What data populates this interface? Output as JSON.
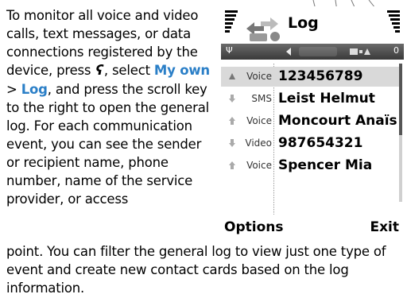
{
  "manual": {
    "p1_a": "To monitor all voice and video calls, text messages, or data connections registered by the device, press",
    "p1_b": ", select",
    "my_own": "My own",
    "gt": ">",
    "log_link": "Log",
    "p1_c": ", and press the scroll key to the right to open the general log. For each communication event, you can see the sender or recipient name, phone number, name of the service provider, or access",
    "p2": "point. You can filter the general log to view just one type of event and create new contact cards based on the log information.",
    "menu_key_icon": "menu-key-icon"
  },
  "phone": {
    "title": "Log",
    "status_left": "Ψ",
    "status_right": "0",
    "entries": [
      {
        "type": "Voice",
        "name": "123456789",
        "icon": "outgoing-call-icon",
        "highlight": true
      },
      {
        "type": "SMS",
        "name": "Leist Helmut",
        "icon": "incoming-arrow-icon",
        "highlight": false
      },
      {
        "type": "Voice",
        "name": "Moncourt Anaïs",
        "icon": "outgoing-arrow-icon",
        "highlight": false
      },
      {
        "type": "Video",
        "name": "987654321",
        "icon": "incoming-arrow-icon",
        "highlight": false
      },
      {
        "type": "Voice",
        "name": "Spencer Mia",
        "icon": "outgoing-arrow-icon",
        "highlight": false
      }
    ],
    "softkeys": {
      "left": "Options",
      "right": "Exit"
    },
    "colors": {
      "link": "#2b7fc7",
      "highlight": "#d9d9d9",
      "status_bar": "#4a4a4a"
    }
  }
}
